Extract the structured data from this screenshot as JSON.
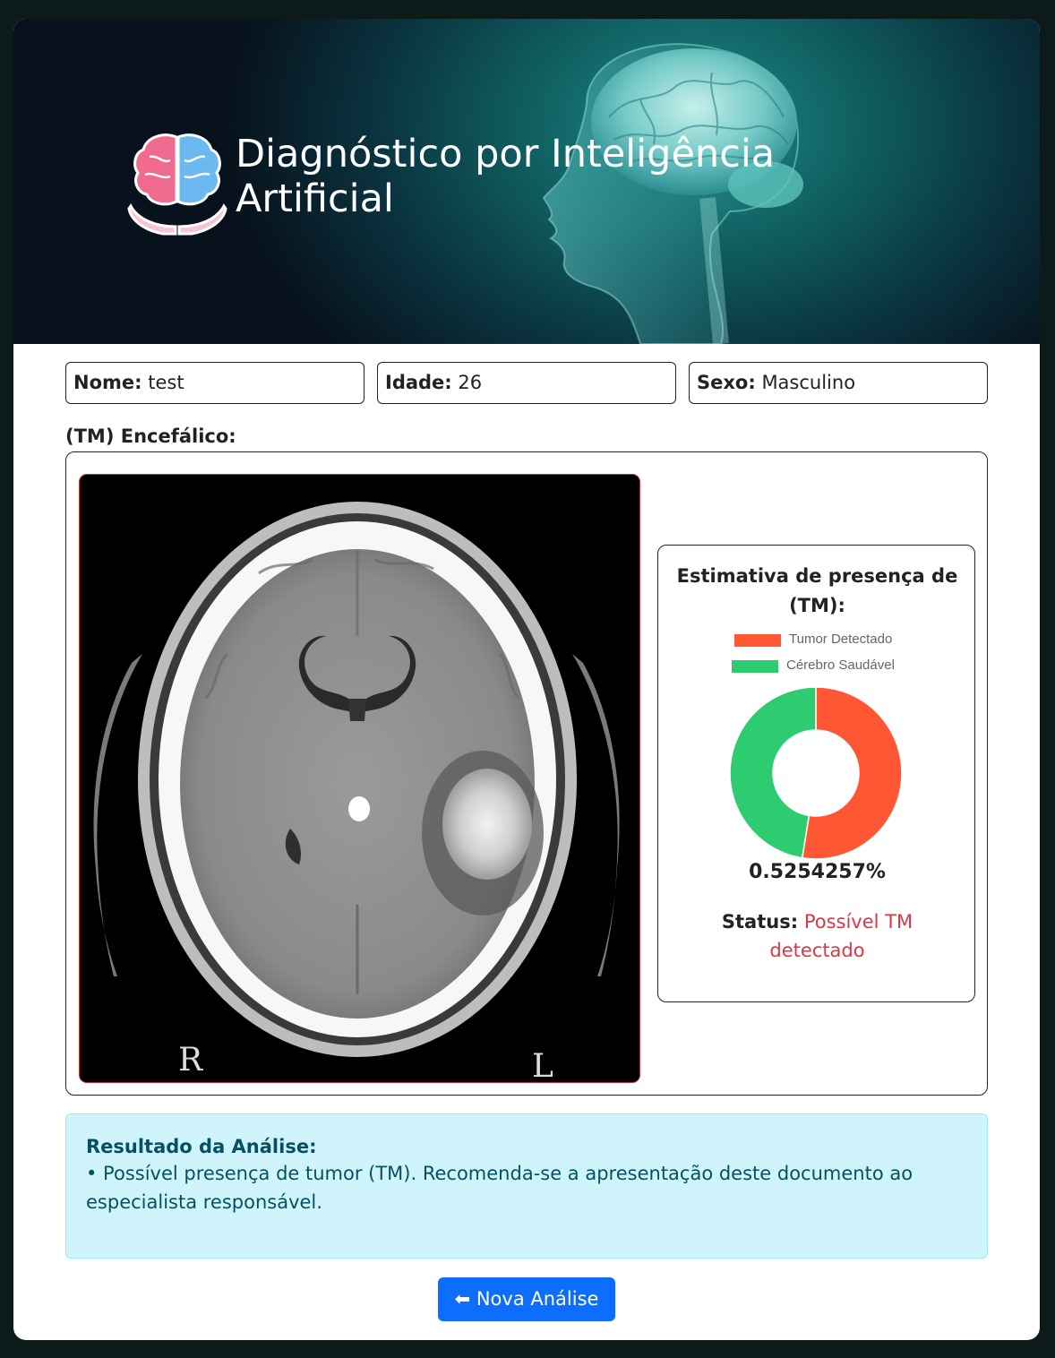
{
  "header": {
    "title_line1": "Diagnóstico por Inteligência",
    "title_line2": "Artificial",
    "logo_icon": "brain-hands-icon"
  },
  "patient": {
    "name_label": "Nome:",
    "name_value": "test",
    "age_label": "Idade:",
    "age_value": "26",
    "sex_label": "Sexo:",
    "sex_value": "Masculino"
  },
  "section_label": "(TM) Encefálico:",
  "scan": {
    "left_marker": "R",
    "right_marker": "L"
  },
  "estimate": {
    "title": "Estimativa de presença de (TM):",
    "legend": [
      {
        "label": "Tumor Detectado",
        "color": "#ff5733"
      },
      {
        "label": "Cérebro Saudável",
        "color": "#2ecc71"
      }
    ],
    "percentage_text": "0.5254257%",
    "status_label": "Status:",
    "status_value": "Possível TM detectado",
    "status_color": "#dc3545"
  },
  "chart_data": {
    "type": "pie",
    "categories": [
      "Tumor Detectado",
      "Cérebro Saudável"
    ],
    "values": [
      0.5254257,
      0.4745743
    ],
    "colors": [
      "#ff5733",
      "#2ecc71"
    ]
  },
  "result": {
    "title": "Resultado da Análise:",
    "text": "• Possível presença de tumor (TM). Recomenda-se a apresentação deste documento ao especialista responsável."
  },
  "actions": {
    "new_analysis_label": "⬅ Nova Análise"
  }
}
